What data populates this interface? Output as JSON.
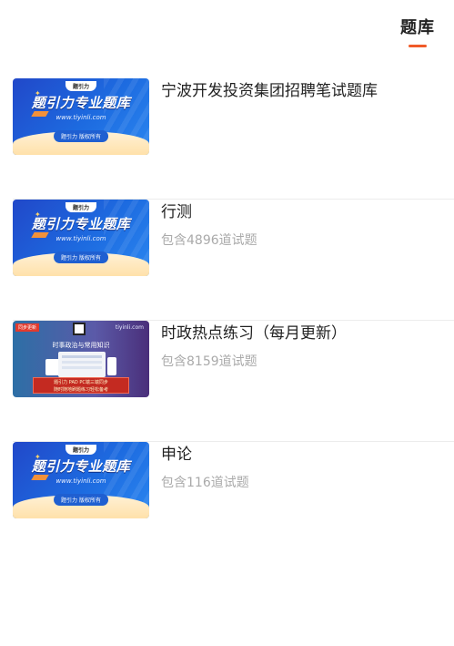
{
  "header": {
    "tab_label": "题库",
    "accent_color": "#f05a28"
  },
  "items": [
    {
      "title": "宁波开发投资集团招聘笔试题库",
      "subtitle": "",
      "thumb": {
        "logo": "题引力",
        "headline": "题引力专业题库",
        "url": "www.tiyinli.com",
        "badge": "题引力 版权所有"
      }
    },
    {
      "title": "行测",
      "subtitle": "包含4896道试题",
      "thumb": {
        "logo": "题引力",
        "headline": "题引力专业题库",
        "url": "www.tiyinli.com",
        "badge": "题引力 版权所有"
      }
    },
    {
      "title": "时政热点练习（每月更新）",
      "subtitle": "包含8159道试题",
      "thumb": {
        "tag": "同步更新",
        "site": "tiyinli.com",
        "heading": "时事政治与常用知识",
        "bar_line1": "题引力 PAD PC端三端同步",
        "bar_line2": "随时随地刷题练习轻松备考"
      }
    },
    {
      "title": "申论",
      "subtitle": "包含116道试题",
      "thumb": {
        "logo": "题引力",
        "headline": "题引力专业题库",
        "url": "www.tiyinli.com",
        "badge": "题引力 版权所有"
      }
    }
  ]
}
